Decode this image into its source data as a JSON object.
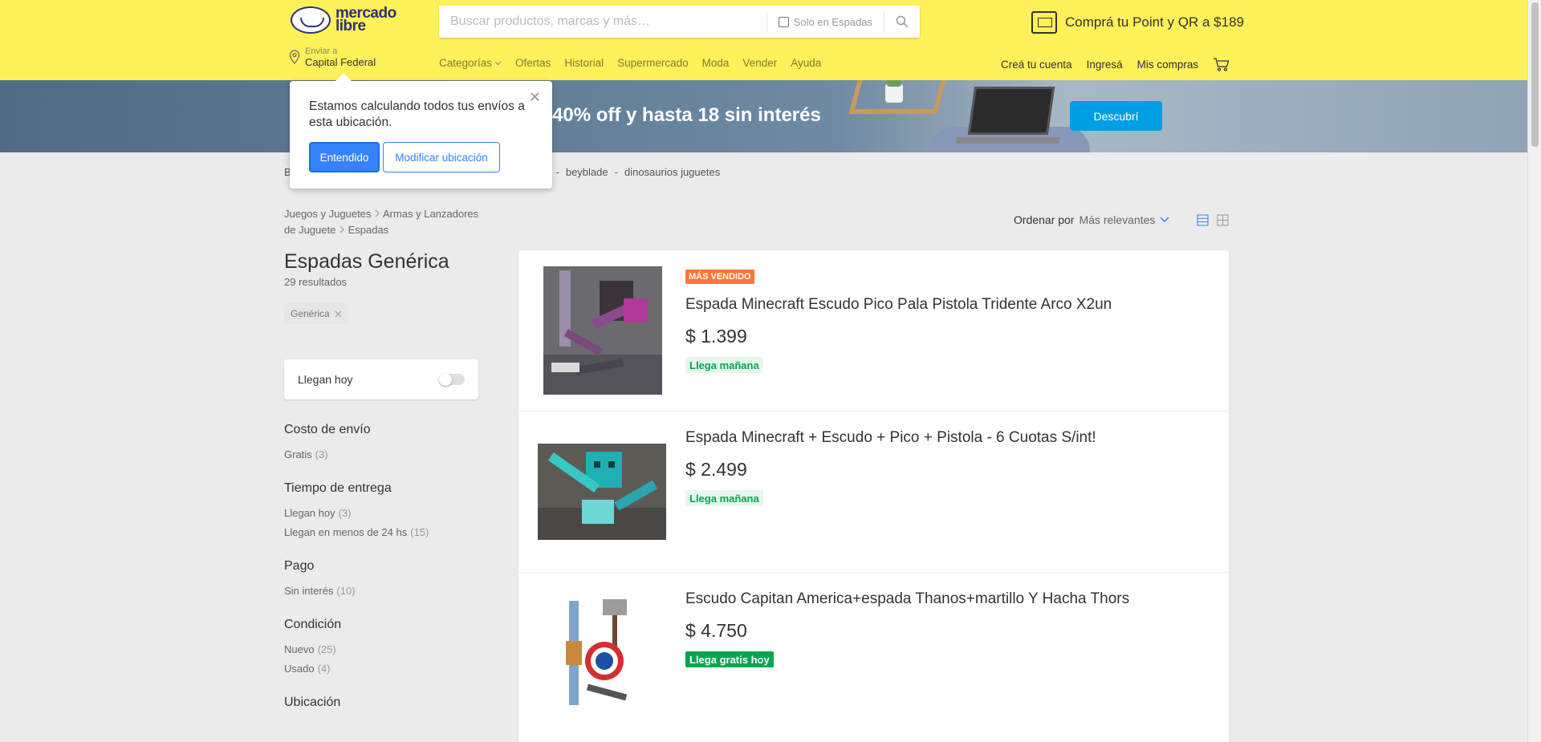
{
  "header": {
    "logo_line1": "mercado",
    "logo_line2": "libre",
    "search_placeholder": "Buscar productos, marcas y más…",
    "solo_label": "Solo en Espadas",
    "promo": "Comprá tu Point y QR a $189",
    "location_small": "Enviar a",
    "location_big": "Capital Federal",
    "nav": [
      "Categorías",
      "Ofertas",
      "Historial",
      "Supermercado",
      "Moda",
      "Vender",
      "Ayuda"
    ],
    "nav_right": [
      "Creá tu cuenta",
      "Ingresá",
      "Mis compras"
    ]
  },
  "banner": {
    "text": "a 40% off y hasta 18 sin interés",
    "button": "Descubrí"
  },
  "popover": {
    "text": "Estamos calculando todos tus envíos a esta ubicación.",
    "primary": "Entendido",
    "secondary": "Modificar ubicación"
  },
  "related": {
    "first": "B",
    "partial": "y",
    "items": [
      "beyblade",
      "dinosaurios juguetes"
    ],
    "sep": "-"
  },
  "sidebar": {
    "crumb1": "Juegos y Juguetes",
    "crumb2a": "Armas y Lanzadores",
    "crumb2b": "de Juguete",
    "crumb3": "Espadas",
    "title": "Espadas Genérica",
    "results": "29 resultados",
    "chip": "Genérica",
    "toggle_label": "Llegan hoy",
    "filters": [
      {
        "title": "Costo de envío",
        "items": [
          {
            "label": "Gratis",
            "count": "(3)"
          }
        ]
      },
      {
        "title": "Tiempo de entrega",
        "items": [
          {
            "label": "Llegan hoy",
            "count": "(3)"
          },
          {
            "label": "Llegan en menos de 24 hs",
            "count": "(15)"
          }
        ]
      },
      {
        "title": "Pago",
        "items": [
          {
            "label": "Sin interés",
            "count": "(10)"
          }
        ]
      },
      {
        "title": "Condición",
        "items": [
          {
            "label": "Nuevo",
            "count": "(25)"
          },
          {
            "label": "Usado",
            "count": "(4)"
          }
        ]
      },
      {
        "title": "Ubicación",
        "items": []
      }
    ]
  },
  "sort": {
    "label": "Ordenar por",
    "value": "Más relevantes"
  },
  "items": [
    {
      "badge": "MÁS VENDIDO",
      "title": "Espada Minecraft Escudo Pico Pala Pistola Tridente Arco X2un",
      "price": "$ 1.399",
      "shipping": "Llega mañana"
    },
    {
      "title": "Espada Minecraft + Escudo + Pico + Pistola - 6 Cuotas S/int!",
      "price": "$ 2.499",
      "shipping": "Llega mañana"
    },
    {
      "title": "Escudo Capitan America+espada Thanos+martillo Y Hacha Thors",
      "price": "$ 4.750",
      "shipping": "Llega gratis hoy"
    }
  ],
  "colors": {
    "header": "#fff159",
    "accent": "#3483fa",
    "banner_button": "#009ee3",
    "badge": "#ff7733",
    "shipping": "#00a650"
  }
}
